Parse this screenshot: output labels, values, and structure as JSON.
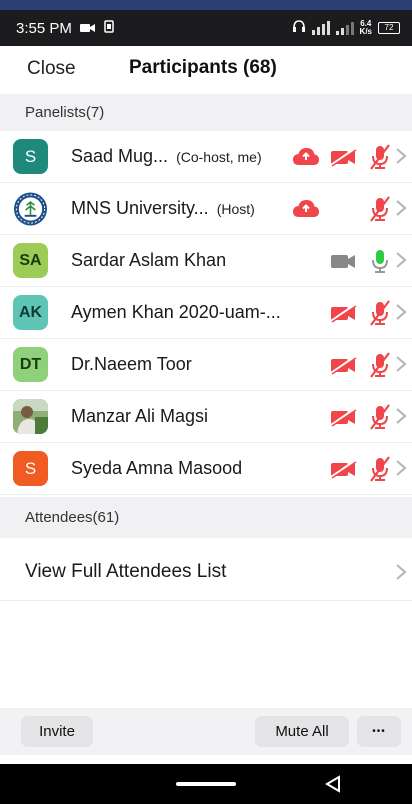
{
  "status_bar": {
    "time": "3:55 PM",
    "speed_value": "6.4",
    "speed_unit": "K/s",
    "battery": "72"
  },
  "header": {
    "close_label": "Close",
    "title": "Participants (68)"
  },
  "panelists_section": {
    "label": "Panelists(7)"
  },
  "participants": [
    {
      "name": "Saad Mug...",
      "role": "(Co-host, me)",
      "avatar_text": "S",
      "avatar_color": "#1f8a7c"
    },
    {
      "name": "MNS University...",
      "role": "(Host)",
      "avatar_text": "",
      "avatar_color": "#ffffff"
    },
    {
      "name": "Sardar Aslam Khan",
      "role": "",
      "avatar_text": "SA",
      "avatar_color": "#9ccc55"
    },
    {
      "name": "Aymen Khan 2020-uam-...",
      "role": "",
      "avatar_text": "AK",
      "avatar_color": "#5ec5b6"
    },
    {
      "name": "Dr.Naeem Toor",
      "role": "",
      "avatar_text": "DT",
      "avatar_color": "#8fd07a"
    },
    {
      "name": "Manzar Ali Magsi",
      "role": "",
      "avatar_text": "",
      "avatar_color": "#6a8a5a"
    },
    {
      "name": "Syeda Amna Masood",
      "role": "",
      "avatar_text": "S",
      "avatar_color": "#f05a23"
    }
  ],
  "attendees_section": {
    "label": "Attendees(61)"
  },
  "view_attendees_label": "View Full Attendees List",
  "bottom_bar": {
    "invite_label": "Invite",
    "mute_all_label": "Mute All",
    "more_label": "•••"
  },
  "colors": {
    "muted_red": "#f0464b",
    "unmuted_green": "#2ecc40",
    "camera_on_gray": "#888888",
    "section_bg": "#f1f1f3"
  }
}
